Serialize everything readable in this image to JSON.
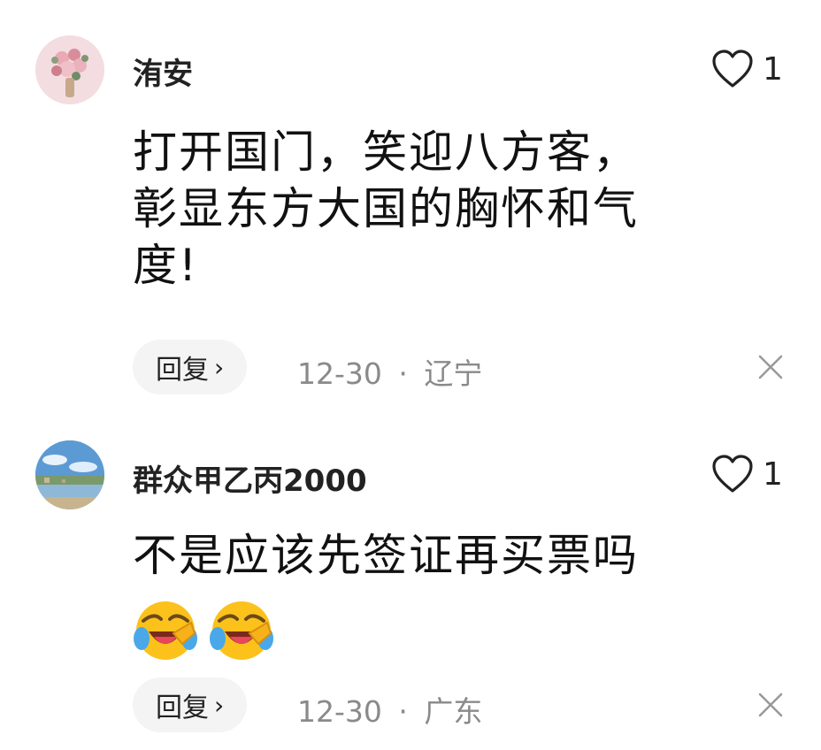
{
  "comments": [
    {
      "username": "洧安",
      "likes": "1",
      "content_lines": [
        "打开国门，笑迎八方客，",
        "彰显东方大国的胸怀和气",
        "度!"
      ],
      "reply_label": "回复",
      "date": "12-30",
      "location": "辽宁",
      "avatar_icon": "flower-bouquet-avatar"
    },
    {
      "username": "群众甲乙丙2000",
      "likes": "1",
      "content_lines": [
        "不是应该先签证再买票吗"
      ],
      "emojis": [
        "laughing-crying-emoji",
        "laughing-crying-emoji"
      ],
      "reply_label": "回复",
      "date": "12-30",
      "location": "广东",
      "avatar_icon": "landscape-avatar"
    }
  ],
  "separator": "·",
  "colors": {
    "text": "#1a1a1a",
    "meta": "#8a8a8a",
    "reply_bg": "#f4f4f4"
  }
}
